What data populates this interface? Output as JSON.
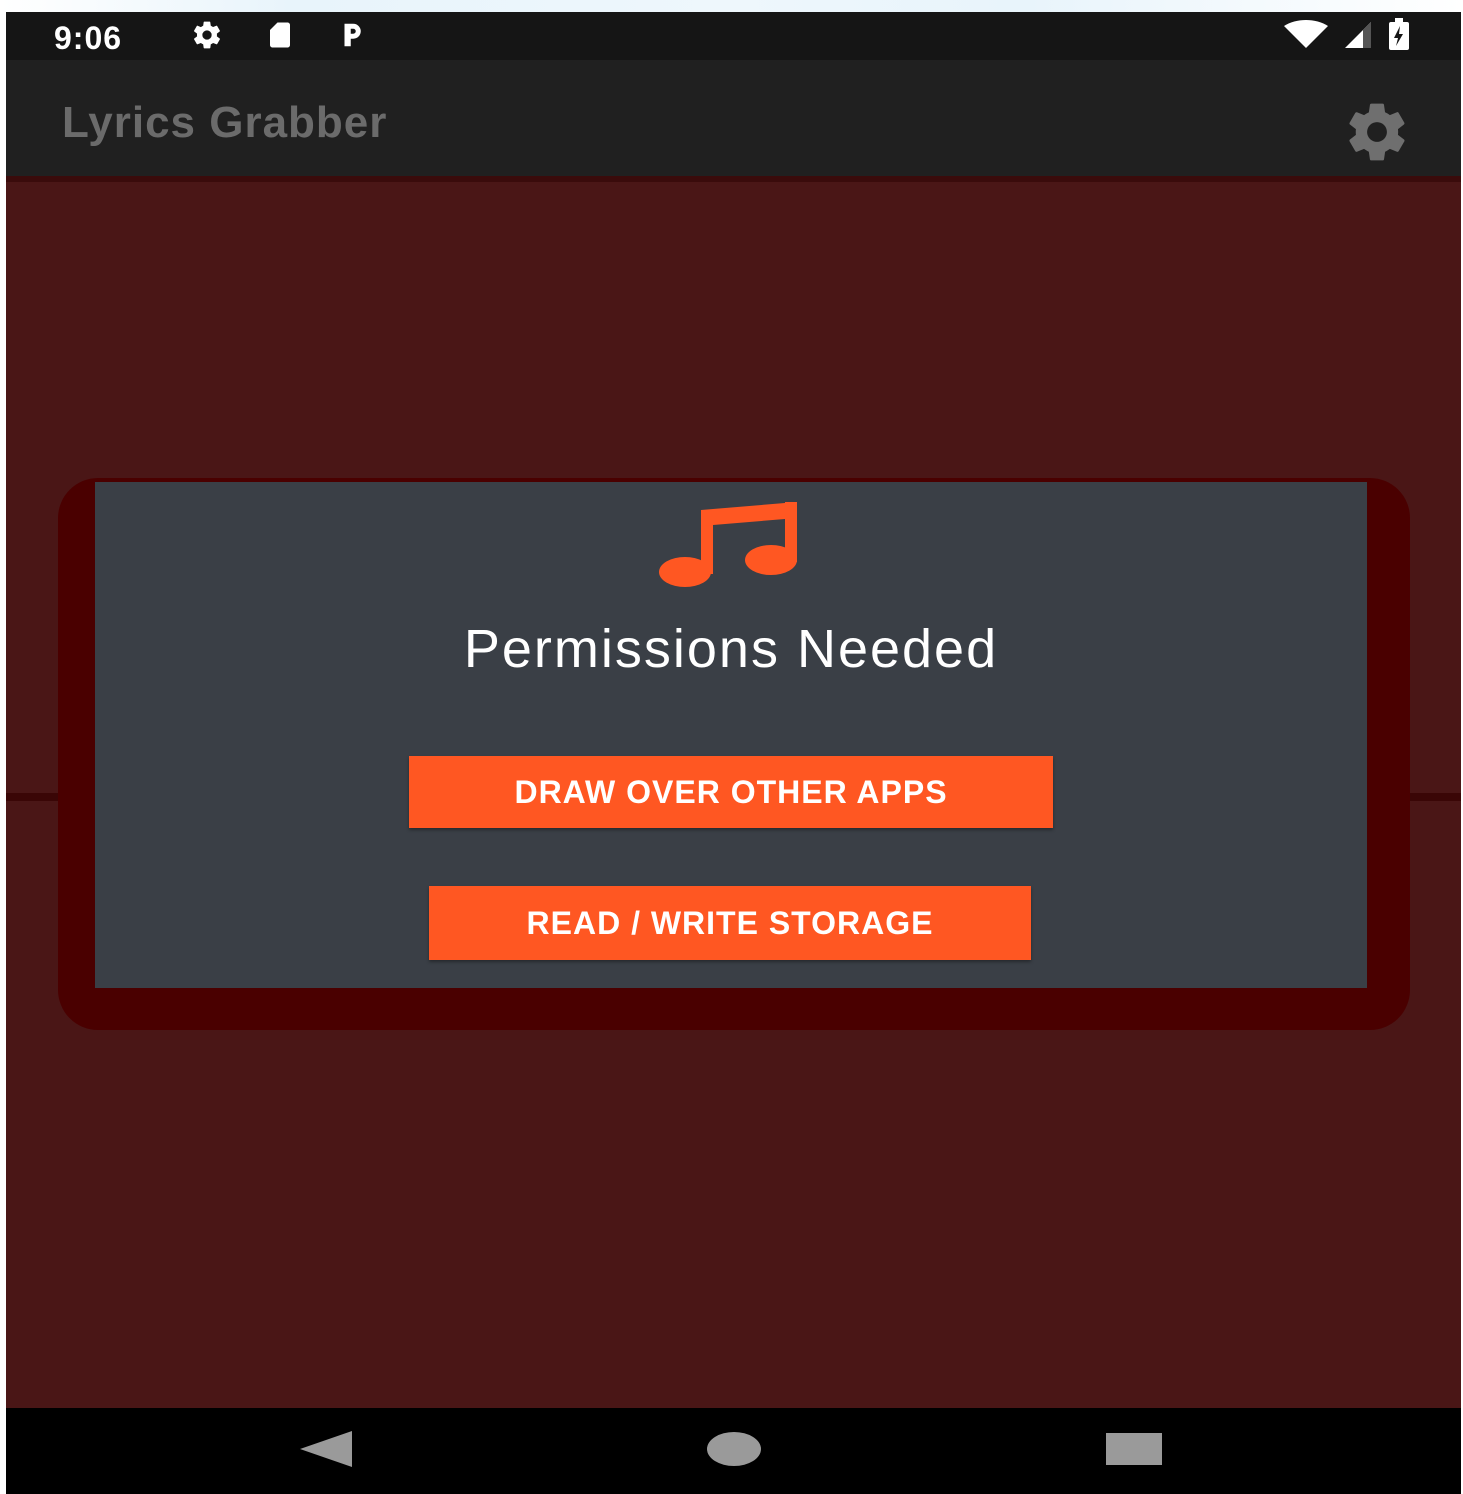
{
  "status_bar": {
    "time": "9:06",
    "left_icons": [
      "settings-icon",
      "sd-card-icon",
      "parking-icon"
    ],
    "right_icons": [
      "wifi-icon",
      "signal-icon",
      "battery-charging-icon"
    ]
  },
  "app_bar": {
    "title": "Lyrics Grabber",
    "settings_icon": "gear-icon"
  },
  "card": {
    "icon": "music-note-icon",
    "title": "Permissions Needed",
    "buttons": {
      "draw_over": "DRAW OVER OTHER APPS",
      "storage": "READ / WRITE STORAGE"
    }
  },
  "nav_bar": {
    "back": "back-icon",
    "home": "home-icon",
    "recents": "recents-icon"
  },
  "colors": {
    "accent": "#ff5722",
    "background": "#4a1616",
    "card": "#3a3f46",
    "app_bar": "#202020"
  }
}
